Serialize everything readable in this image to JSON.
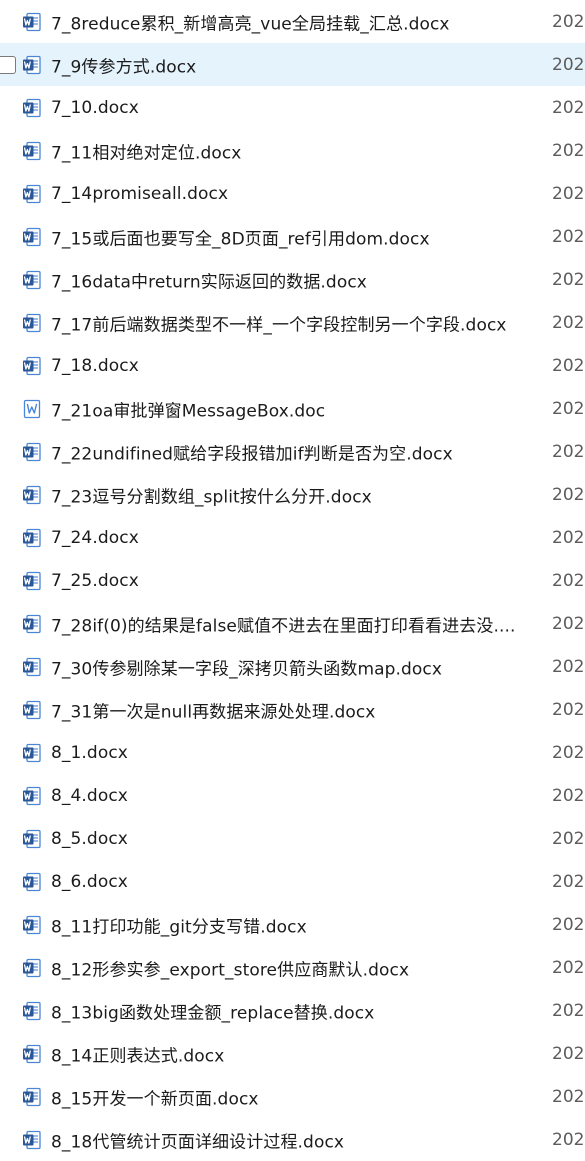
{
  "files": [
    {
      "name": "7_8reduce累积_新增高亮_vue全局挂载_汇总.docx",
      "date": "202",
      "icon": "word-docx-icon"
    },
    {
      "name": "7_9传参方式.docx",
      "date": "202",
      "icon": "word-docx-icon",
      "selected": true
    },
    {
      "name": "7_10.docx",
      "date": "202",
      "icon": "word-docx-icon"
    },
    {
      "name": "7_11相对绝对定位.docx",
      "date": "202",
      "icon": "word-docx-icon"
    },
    {
      "name": "7_14promiseall.docx",
      "date": "202",
      "icon": "word-docx-icon"
    },
    {
      "name": "7_15或后面也要写全_8D页面_ref引用dom.docx",
      "date": "202",
      "icon": "word-docx-icon"
    },
    {
      "name": "7_16data中return实际返回的数据.docx",
      "date": "202",
      "icon": "word-docx-icon"
    },
    {
      "name": "7_17前后端数据类型不一样_一个字段控制另一个字段.docx",
      "date": "202",
      "icon": "word-docx-icon"
    },
    {
      "name": "7_18.docx",
      "date": "202",
      "icon": "word-docx-icon"
    },
    {
      "name": "7_21oa审批弹窗MessageBox.doc",
      "date": "202",
      "icon": "word-doc-icon"
    },
    {
      "name": "7_22undifined赋给字段报错加if判断是否为空.docx",
      "date": "202",
      "icon": "word-docx-icon"
    },
    {
      "name": "7_23逗号分割数组_split按什么分开.docx",
      "date": "202",
      "icon": "word-docx-icon"
    },
    {
      "name": "7_24.docx",
      "date": "202",
      "icon": "word-docx-icon"
    },
    {
      "name": "7_25.docx",
      "date": "202",
      "icon": "word-docx-icon"
    },
    {
      "name": "7_28if(0)的结果是false赋值不进去在里面打印看看进去没....",
      "date": "202",
      "icon": "word-docx-icon"
    },
    {
      "name": "7_30传参剔除某一字段_深拷贝箭头函数map.docx",
      "date": "202",
      "icon": "word-docx-icon"
    },
    {
      "name": "7_31第一次是null再数据来源处处理.docx",
      "date": "202",
      "icon": "word-docx-icon"
    },
    {
      "name": "8_1.docx",
      "date": "202",
      "icon": "word-docx-icon"
    },
    {
      "name": "8_4.docx",
      "date": "202",
      "icon": "word-docx-icon"
    },
    {
      "name": "8_5.docx",
      "date": "202",
      "icon": "word-docx-icon"
    },
    {
      "name": "8_6.docx",
      "date": "202",
      "icon": "word-docx-icon"
    },
    {
      "name": "8_11打印功能_git分支写错.docx",
      "date": "202",
      "icon": "word-docx-icon"
    },
    {
      "name": "8_12形参实参_export_store供应商默认.docx",
      "date": "202",
      "icon": "word-docx-icon"
    },
    {
      "name": "8_13big函数处理金额_replace替换.docx",
      "date": "202",
      "icon": "word-docx-icon"
    },
    {
      "name": "8_14正则表达式.docx",
      "date": "202",
      "icon": "word-docx-icon"
    },
    {
      "name": "8_15开发一个新页面.docx",
      "date": "202",
      "icon": "word-docx-icon"
    },
    {
      "name": "8_18代管统计页面详细设计过程.docx",
      "date": "202",
      "icon": "word-docx-icon"
    }
  ],
  "colors": {
    "selected_bg": "#e5f3fd",
    "word_blue": "#2b5797",
    "word_light": "#4a86d8"
  }
}
